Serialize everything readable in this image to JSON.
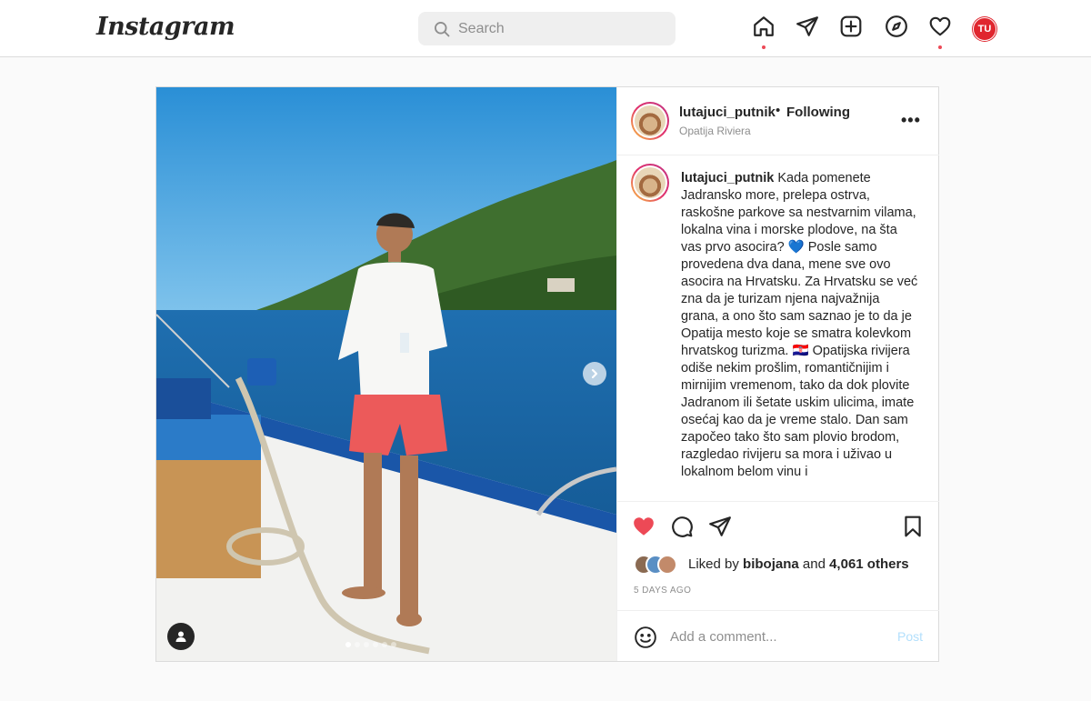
{
  "nav": {
    "logo": "Instagram",
    "search_placeholder": "Search",
    "avatar_initials": "TU",
    "icons": [
      "home-icon",
      "direct-icon",
      "new-post-icon",
      "explore-icon",
      "activity-icon"
    ],
    "accent_color": "#ed4956"
  },
  "post": {
    "username": "lutajuci_putnik",
    "separator": "•",
    "follow_status": "Following",
    "location": "Opatija Riviera",
    "more_label": "•••",
    "caption": "Kada pomenete Jadransko more, prelepa ostrva, raskošne parkove sa nestvarnim vilama, lokalna vina i morske plodove, na šta vas prvo asocira? 💙 Posle samo provedena dva dana, mene sve ovo asocira na Hrvatsku. Za Hrvatsku se već zna da je turizam njena najvažnija grana, a ono što sam saznao je to da je Opatija mesto koje se smatra kolevkom hrvatskog turizma. 🇭🇷 Opatijska rivijera odiše nekim prošlim, romantičnijim i mirnijim vremenom, tako da dok plovite Jadranom ili šetate uskim ulicima, imate osećaj kao da je vreme stalo. Dan sam započeo tako što sam plovio brodom, razgledao rivijeru sa mora i uživao u lokalnom belom vinu i",
    "liked_prefix": "Liked by ",
    "liked_by": "bibojana",
    "liked_mid": " and ",
    "liked_count": "4,061 others",
    "time": "5 DAYS AGO",
    "comment_placeholder": "Add a comment...",
    "post_label": "Post",
    "carousel": {
      "slides": 6,
      "active": 1
    }
  }
}
